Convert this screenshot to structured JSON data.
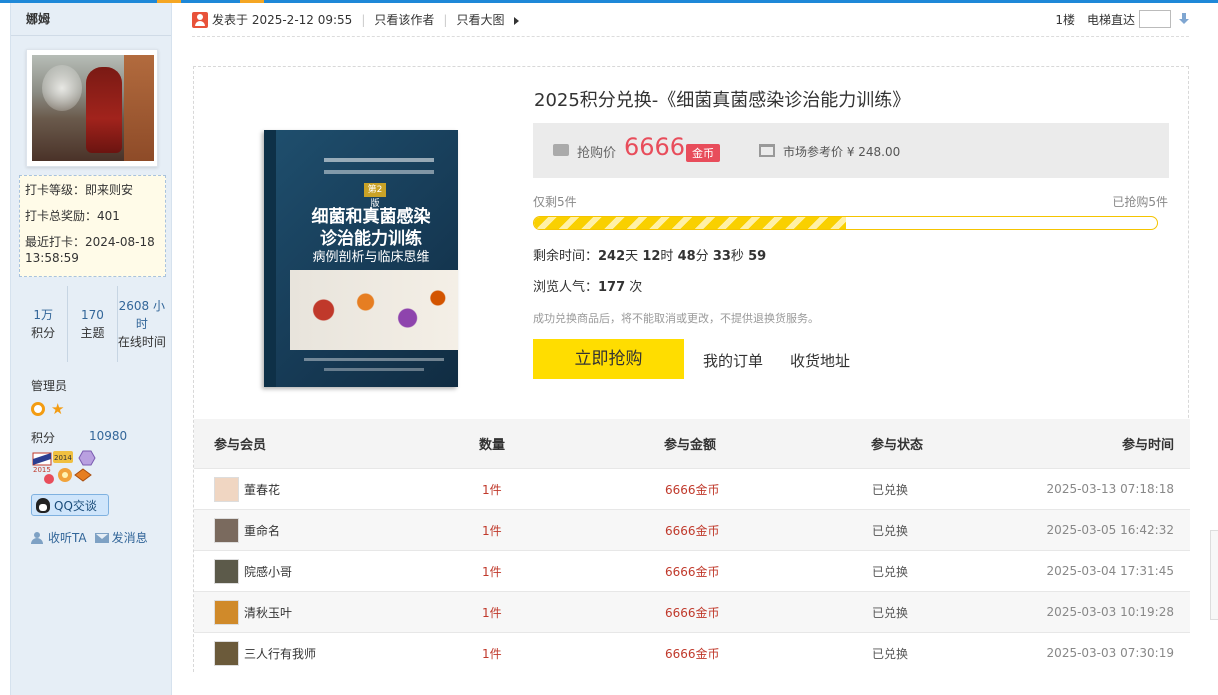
{
  "user": {
    "name": "娜姆",
    "checkin_level": "打卡等级：即来则安",
    "checkin_reward": "打卡总奖励：401",
    "checkin_last": "最近打卡：2024-08-18 13:58:59",
    "stats": [
      {
        "num": "1万",
        "label": "积分"
      },
      {
        "num": "170",
        "label": "主题"
      },
      {
        "num": "2608 小时",
        "label": "在线时间"
      }
    ],
    "role": "管理员",
    "points_label": "积分",
    "points_value": "10980",
    "medal_year_a": "2015",
    "medal_year_b": "2014",
    "qq_button": "QQ交谈",
    "follow": "收听TA",
    "message": "发消息"
  },
  "post_header": {
    "posted": "发表于 2025-2-12 09:55",
    "author_only": "只看该作者",
    "big_image": "只看大图",
    "floor": "1楼",
    "jump_label": "电梯直达",
    "jump_value": ""
  },
  "product": {
    "title": "2025积分兑换-《细菌真菌感染诊治能力训练》",
    "book_cover": {
      "title_line1": "细菌和真菌感染",
      "title_line2": "诊治能力训练",
      "subtitle": "病例剖析与临床思维",
      "edition": "第2版"
    },
    "buy_label": "抢购价",
    "buy_price": "6666",
    "currency_tag": "金币",
    "market_label": "市场参考价 ¥ 248.00",
    "stock_left": "仅剩5件",
    "sold": "已抢购5件",
    "progress_fraction": 0.5,
    "countdown": {
      "prefix": "剩余时间：",
      "days": "242",
      "d_unit": "天",
      "hours": "12",
      "h_unit": "时",
      "minutes": "48",
      "m_unit": "分",
      "seconds": "33",
      "s_unit": "秒",
      "ticks": "59"
    },
    "views": {
      "prefix": "浏览人气：",
      "count": "177",
      "unit": "次"
    },
    "notice": "成功兑换商品后，将不能取消或更改，不提供退换货服务。",
    "buy_button": "立即抢购",
    "my_orders": "我的订单",
    "address": "收货地址"
  },
  "table": {
    "headers": [
      "参与会员",
      "数量",
      "参与金额",
      "参与状态",
      "参与时间"
    ],
    "rows": [
      {
        "member": "董春花",
        "qty": "1件",
        "amount": "6666金币",
        "status": "已兑换",
        "time": "2025-03-13 07:18:18",
        "avatar_color": "#f0d6c2"
      },
      {
        "member": "重命名",
        "qty": "1件",
        "amount": "6666金币",
        "status": "已兑换",
        "time": "2025-03-05 16:42:32",
        "avatar_color": "#7a6a5e"
      },
      {
        "member": "院感小哥",
        "qty": "1件",
        "amount": "6666金币",
        "status": "已兑换",
        "time": "2025-03-04 17:31:45",
        "avatar_color": "#5c5a4a"
      },
      {
        "member": "清秋玉叶",
        "qty": "1件",
        "amount": "6666金币",
        "status": "已兑换",
        "time": "2025-03-03 10:19:28",
        "avatar_color": "#d08a2a"
      },
      {
        "member": "三人行有我师",
        "qty": "1件",
        "amount": "6666金币",
        "status": "已兑换",
        "time": "2025-03-03 07:30:19",
        "avatar_color": "#6b5a3a"
      }
    ]
  },
  "colors": {
    "accent_blue": "#1e88d8",
    "price_red": "#e84d5b",
    "button_yellow": "#ffdd00",
    "link_blue": "#336699"
  }
}
